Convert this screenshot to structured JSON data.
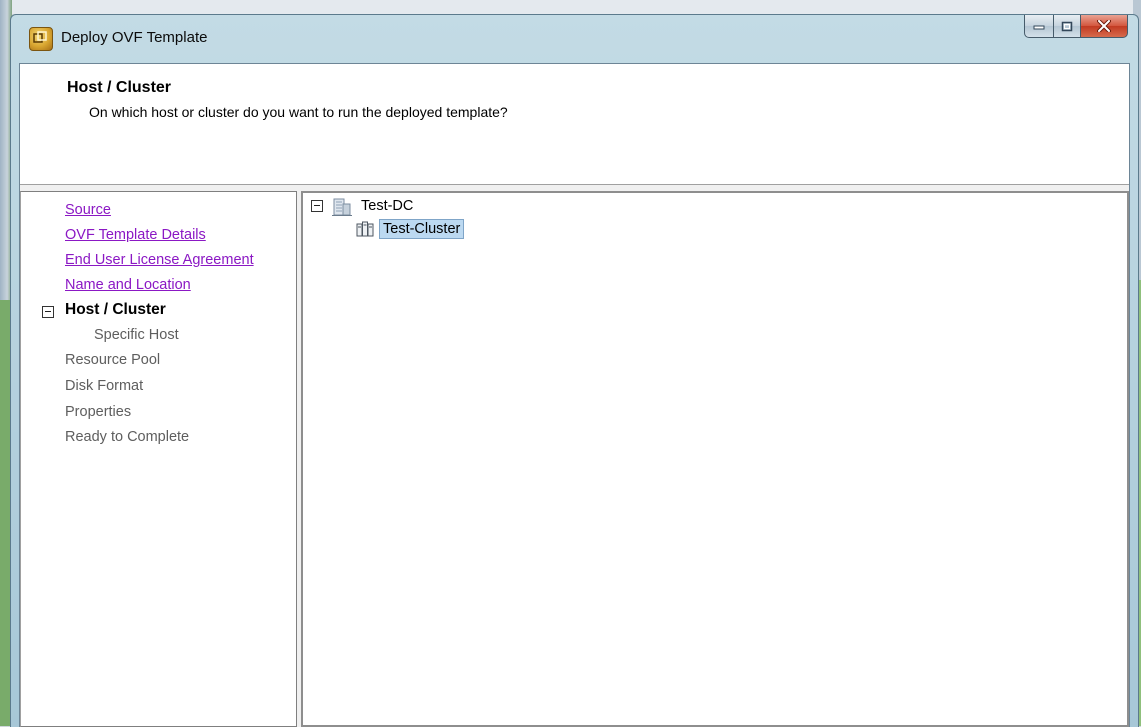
{
  "window": {
    "title": "Deploy OVF Template",
    "controls": {
      "minimize": "minimize",
      "maximize": "maximize",
      "close": "close"
    }
  },
  "header": {
    "title": "Host / Cluster",
    "description": "On which host or cluster do you want to run the deployed template?"
  },
  "nav": {
    "items": [
      {
        "label": "Source",
        "state": "done"
      },
      {
        "label": "OVF Template Details",
        "state": "done"
      },
      {
        "label": "End User License Agreement",
        "state": "done"
      },
      {
        "label": "Name and Location",
        "state": "done"
      },
      {
        "label": "Host / Cluster",
        "state": "current"
      },
      {
        "label": "Specific Host",
        "state": "pending"
      },
      {
        "label": "Resource Pool",
        "state": "pending"
      },
      {
        "label": "Disk Format",
        "state": "pending"
      },
      {
        "label": "Properties",
        "state": "pending"
      },
      {
        "label": "Ready to Complete",
        "state": "pending"
      }
    ]
  },
  "tree": {
    "datacenter": {
      "label": "Test-DC",
      "icon": "datacenter-icon",
      "expanded": true
    },
    "cluster": {
      "label": "Test-Cluster",
      "icon": "cluster-icon",
      "selected": true
    }
  },
  "colors": {
    "link_visited": "#8b18c4",
    "selection": "#bcd9f1",
    "close_button": "#c23a22"
  }
}
